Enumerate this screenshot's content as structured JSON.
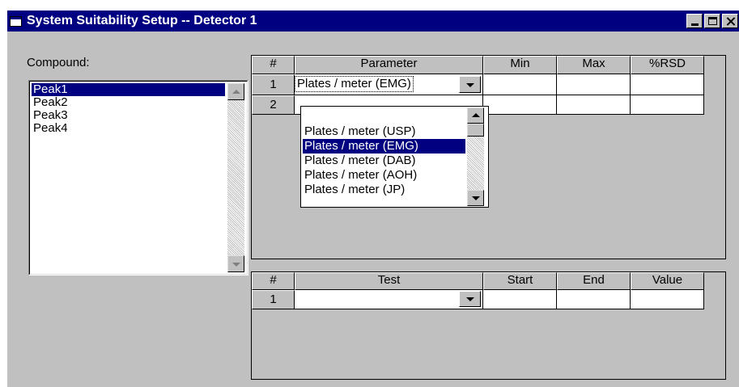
{
  "window": {
    "title": "System Suitability Setup -- Detector 1",
    "title_bg": "#000080"
  },
  "compound": {
    "label": "Compound:",
    "items": [
      "Peak1",
      "Peak2",
      "Peak3",
      "Peak4"
    ],
    "selected": "Peak1"
  },
  "param_grid": {
    "headers": [
      "#",
      "Parameter",
      "Min",
      "Max",
      "%RSD"
    ],
    "rows": [
      {
        "num": "1",
        "parameter": "Plates / meter (EMG)",
        "min": "",
        "max": "",
        "rsd": ""
      },
      {
        "num": "2",
        "parameter": "",
        "min": "",
        "max": "",
        "rsd": ""
      }
    ],
    "dropdown_options": [
      "Plates / meter (USP)",
      "Plates / meter (EMG)",
      "Plates / meter (DAB)",
      "Plates / meter (AOH)",
      "Plates / meter (JP)"
    ],
    "dropdown_selected": "Plates / meter (EMG)"
  },
  "test_grid": {
    "headers": [
      "#",
      "Test",
      "Start",
      "End",
      "Value"
    ],
    "rows": [
      {
        "num": "1",
        "test": "",
        "start": "",
        "end": "",
        "value": ""
      }
    ]
  },
  "colors": {
    "face": "#c0c0c0",
    "selection": "#000080"
  }
}
